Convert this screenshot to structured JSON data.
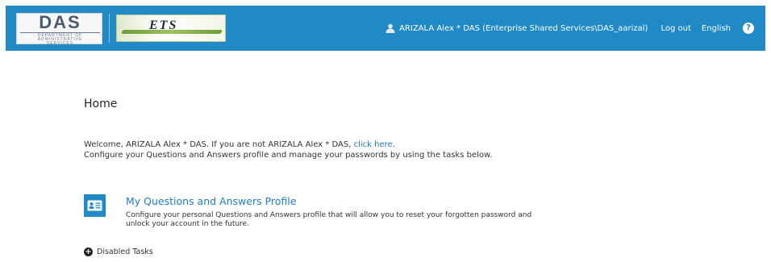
{
  "header": {
    "das_logo": {
      "big": "DAS",
      "line1": "DEPARTMENT OF",
      "line2": "ADMINISTRATIVE",
      "line3": "SERVICES"
    },
    "ets_logo": {
      "mark": "ETS"
    },
    "user_name": "ARIZALA Alex * DAS (Enterprise Shared Services\\DAS_aarizal)",
    "logout_label": "Log out",
    "language_label": "English",
    "help_glyph": "?",
    "icons": {
      "user": "user-icon",
      "help": "help-icon"
    }
  },
  "main": {
    "title": "Home",
    "welcome_prefix": "Welcome, ARIZALA Alex * DAS. If you are not ARIZALA Alex * DAS, ",
    "welcome_link": "click here",
    "welcome_suffix": ".",
    "instructions": "Configure your Questions and Answers profile and manage your passwords by using the tasks below.",
    "task": {
      "title": "My Questions and Answers Profile",
      "description": "Configure your personal Questions and Answers profile that will allow you to reset your forgotten password and unlock your account in the future.",
      "icon": "profile-card-icon"
    },
    "disabled_tasks_label": "Disabled Tasks",
    "disabled_tasks_icon": "plus-circle-icon"
  },
  "colors": {
    "header_bg": "#1f8ac6",
    "link": "#1f7dc0",
    "text": "#333333"
  }
}
